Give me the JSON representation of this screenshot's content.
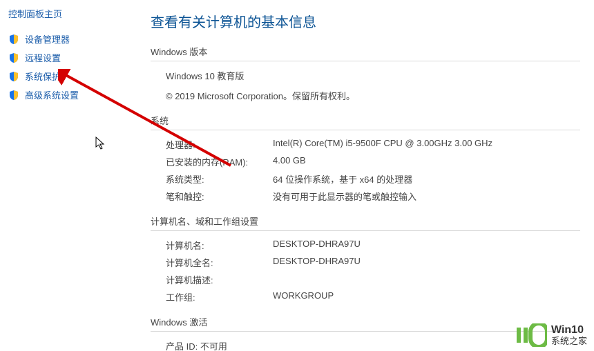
{
  "sidebar": {
    "home": "控制面板主页",
    "items": [
      {
        "label": "设备管理器"
      },
      {
        "label": "远程设置"
      },
      {
        "label": "系统保护"
      },
      {
        "label": "高级系统设置"
      }
    ]
  },
  "main": {
    "title": "查看有关计算机的基本信息",
    "win_version": {
      "heading": "Windows 版本",
      "name": "Windows 10 教育版",
      "copyright": "© 2019 Microsoft Corporation。保留所有权利。"
    },
    "system": {
      "heading": "系统",
      "rows": [
        {
          "label": "处理器:",
          "value": "Intel(R) Core(TM) i5-9500F CPU @ 3.00GHz   3.00 GHz"
        },
        {
          "label": "已安装的内存(RAM):",
          "value": "4.00 GB"
        },
        {
          "label": "系统类型:",
          "value": "64 位操作系统，基于 x64 的处理器"
        },
        {
          "label": "笔和触控:",
          "value": "没有可用于此显示器的笔或触控输入"
        }
      ]
    },
    "computer_domain": {
      "heading": "计算机名、域和工作组设置",
      "rows": [
        {
          "label": "计算机名:",
          "value": "DESKTOP-DHRA97U"
        },
        {
          "label": "计算机全名:",
          "value": "DESKTOP-DHRA97U"
        },
        {
          "label": "计算机描述:",
          "value": ""
        },
        {
          "label": "工作组:",
          "value": "WORKGROUP"
        }
      ]
    },
    "activation": {
      "heading": "Windows 激活",
      "product_id": "产品 ID: 不可用"
    }
  },
  "watermark": {
    "line1": "Win10",
    "line2": "系统之家"
  }
}
